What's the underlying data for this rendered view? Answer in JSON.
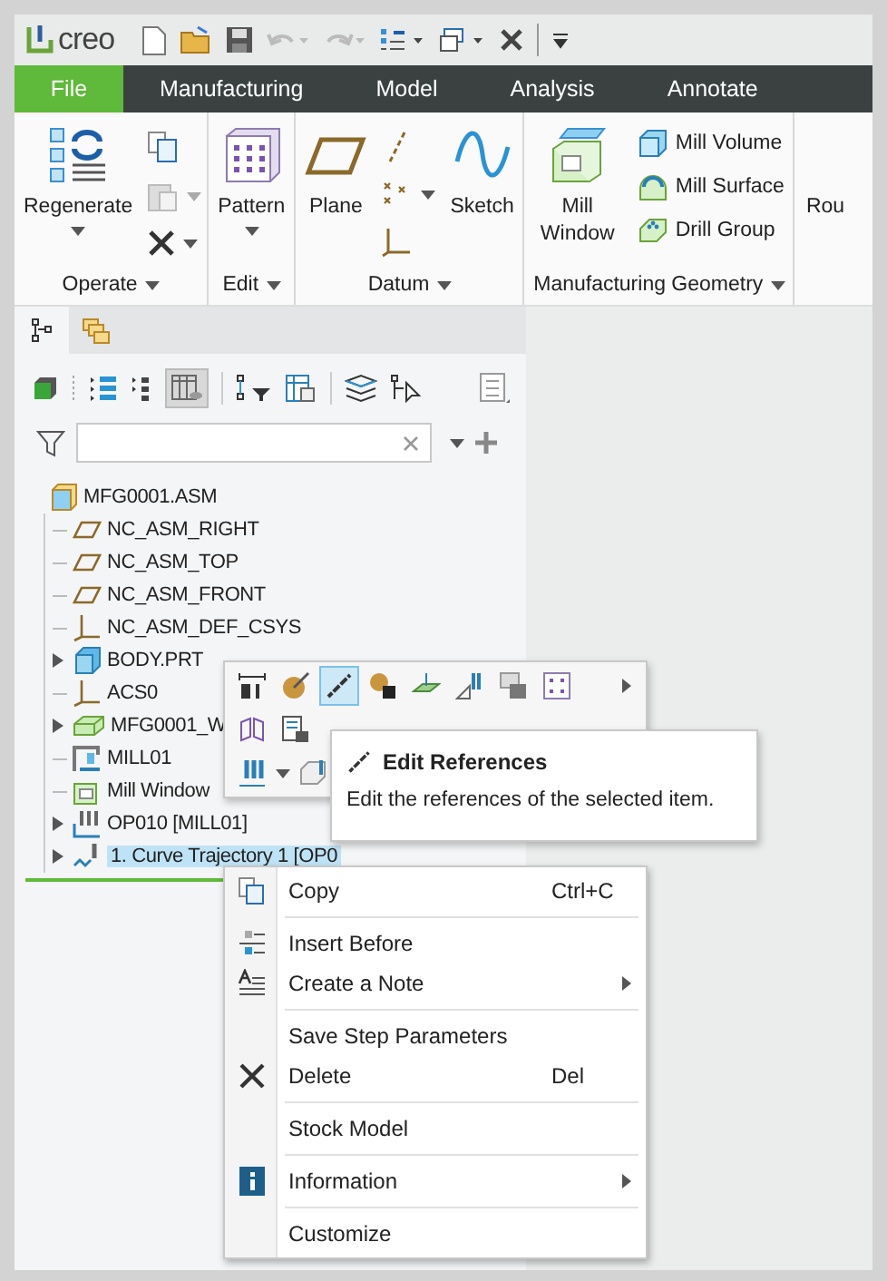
{
  "quick_access": {
    "logo": "creo"
  },
  "menu_tabs": [
    {
      "label": "File",
      "kind": "file"
    },
    {
      "label": "Manufacturing",
      "kind": "tab"
    },
    {
      "label": "Model",
      "kind": "tab"
    },
    {
      "label": "Analysis",
      "kind": "tab"
    },
    {
      "label": "Annotate",
      "kind": "tab"
    }
  ],
  "ribbon": {
    "groups": [
      {
        "label": "Operate",
        "items": [
          {
            "kind": "large",
            "label": "Regenerate",
            "caret": true
          },
          {
            "kind": "icons"
          }
        ]
      },
      {
        "label": "Edit",
        "items": [
          {
            "kind": "large",
            "label": "Pattern",
            "caret": true
          }
        ]
      },
      {
        "label": "Datum",
        "items": [
          {
            "kind": "large",
            "label": "Plane"
          },
          {
            "kind": "icons"
          },
          {
            "kind": "large",
            "label": "Sketch"
          }
        ]
      },
      {
        "label": "Manufacturing Geometry",
        "items": [
          {
            "kind": "large",
            "label": "Mill Window"
          },
          {
            "kind": "stack",
            "labels": [
              "Mill Volume",
              "Mill Surface",
              "Drill Group"
            ]
          }
        ]
      },
      {
        "label": "Rou"
      }
    ]
  },
  "navigator_tabs": [
    {
      "selected": true
    },
    {
      "selected": false
    }
  ],
  "tree": {
    "root": {
      "label": "MFG0001.ASM",
      "children": [
        {
          "label": "NC_ASM_RIGHT",
          "kind": "plane",
          "selected": false
        },
        {
          "label": "NC_ASM_TOP",
          "kind": "plane",
          "selected": false
        },
        {
          "label": "NC_ASM_FRONT",
          "kind": "plane",
          "selected": false
        },
        {
          "label": "NC_ASM_DEF_CSYS",
          "kind": "csys",
          "selected": false
        },
        {
          "label": "BODY.PRT",
          "kind": "part",
          "expanded": false,
          "selected": false
        },
        {
          "label": "ACS0",
          "kind": "csys",
          "selected": false
        },
        {
          "label": "MFG0001_W",
          "kind": "workpiece",
          "expanded": false,
          "selected": false
        },
        {
          "label": "MILL01",
          "kind": "machine",
          "selected": false
        },
        {
          "label": "Mill Window",
          "kind": "window",
          "selected": false
        },
        {
          "label": "OP010 [MILL01]",
          "kind": "operation",
          "expanded": false,
          "selected": false
        },
        {
          "label": "1. Curve Trajectory 1 [OP0",
          "kind": "trajectory",
          "expanded": false,
          "selected": true
        }
      ]
    }
  },
  "mini_toolbar": {
    "rows": [
      [
        {
          "selected": false
        },
        {
          "selected": false
        },
        {
          "selected": true
        },
        {
          "selected": false
        },
        {
          "selected": false
        },
        {
          "selected": false
        },
        {
          "selected": false
        },
        {
          "selected": false
        }
      ],
      [
        {
          "selected": false
        },
        {
          "selected": false
        }
      ],
      [
        {
          "selected": false
        },
        {
          "selected": false
        }
      ]
    ]
  },
  "tooltip": {
    "title": "Edit References",
    "text": "Edit the references of the selected item."
  },
  "context_menu": {
    "groups": [
      [
        {
          "label": "Copy",
          "kind": "copy",
          "shortcut": "Ctrl+C"
        }
      ],
      [
        {
          "label": "Insert Before",
          "kind": "insert"
        },
        {
          "label": "Create a Note",
          "kind": "note",
          "submenu": true
        }
      ],
      [
        {
          "label": "Save Step Parameters",
          "kind": "plain"
        },
        {
          "label": "Delete",
          "kind": "delete",
          "shortcut": "Del"
        }
      ],
      [
        {
          "label": "Stock Model",
          "kind": "plain"
        }
      ],
      [
        {
          "label": "Information",
          "kind": "info",
          "submenu": true
        }
      ],
      [
        {
          "label": "Customize",
          "kind": "plain"
        }
      ]
    ]
  }
}
